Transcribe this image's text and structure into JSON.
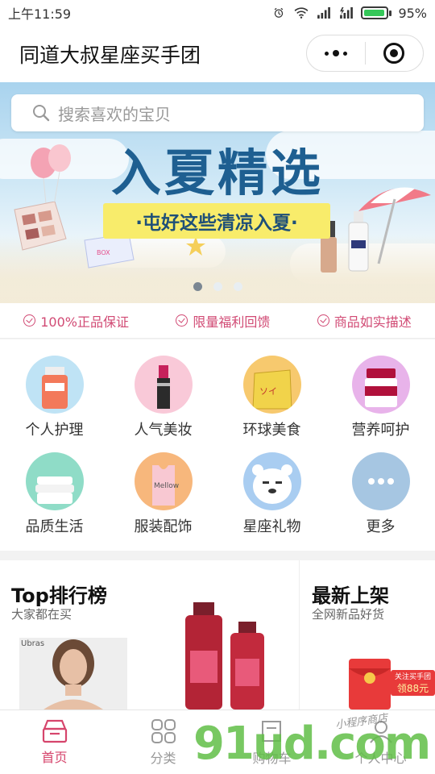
{
  "status_bar": {
    "time": "上午11:59",
    "battery": "95%",
    "battery_level": 0.95
  },
  "header": {
    "title": "同道大叔星座买手团"
  },
  "search": {
    "placeholder": "搜索喜欢的宝贝"
  },
  "banner": {
    "title": "入夏精选",
    "subtitle": "·屯好这些清凉入夏·",
    "page_count": 3,
    "active_page": 0
  },
  "guarantees": [
    "100%正品保证",
    "限量福利回馈",
    "商品如实描述"
  ],
  "categories": [
    {
      "label": "个人护理",
      "icon": "personal-care-icon",
      "bg": "#bfe3f5"
    },
    {
      "label": "人气美妆",
      "icon": "makeup-icon",
      "bg": "#f9c9d8"
    },
    {
      "label": "环球美食",
      "icon": "food-icon",
      "bg": "#f7c96e"
    },
    {
      "label": "营养呵护",
      "icon": "nutrition-icon",
      "bg": "#e8b3ea"
    },
    {
      "label": "品质生活",
      "icon": "lifestyle-icon",
      "bg": "#8fdcc7"
    },
    {
      "label": "服装配饰",
      "icon": "clothing-icon",
      "bg": "#f7b77c"
    },
    {
      "label": "星座礼物",
      "icon": "gift-icon",
      "bg": "#a9cdf1"
    },
    {
      "label": "更多",
      "icon": "more-icon",
      "bg": "#a6c6e2"
    }
  ],
  "rankings": {
    "top": {
      "title": "Top排行榜",
      "subtitle": "大家都在买",
      "brand": "Ubras"
    },
    "new": {
      "title": "最新上架",
      "subtitle": "全网新品好货",
      "promo_line1": "关注买手团",
      "promo_line2": "领88元"
    }
  },
  "tabs": [
    {
      "label": "首页",
      "icon": "home-icon",
      "active": true
    },
    {
      "label": "分类",
      "icon": "category-icon",
      "active": false
    },
    {
      "label": "购物车",
      "icon": "cart-icon",
      "active": false
    },
    {
      "label": "个人中心",
      "icon": "profile-icon",
      "active": false
    }
  ],
  "watermark": {
    "text": "91ud.com",
    "caption": "小程序商店"
  },
  "colors": {
    "accent": "#d6456c",
    "banner_title": "#1e5f91",
    "banner_sub_bg": "#f8ec6b"
  }
}
